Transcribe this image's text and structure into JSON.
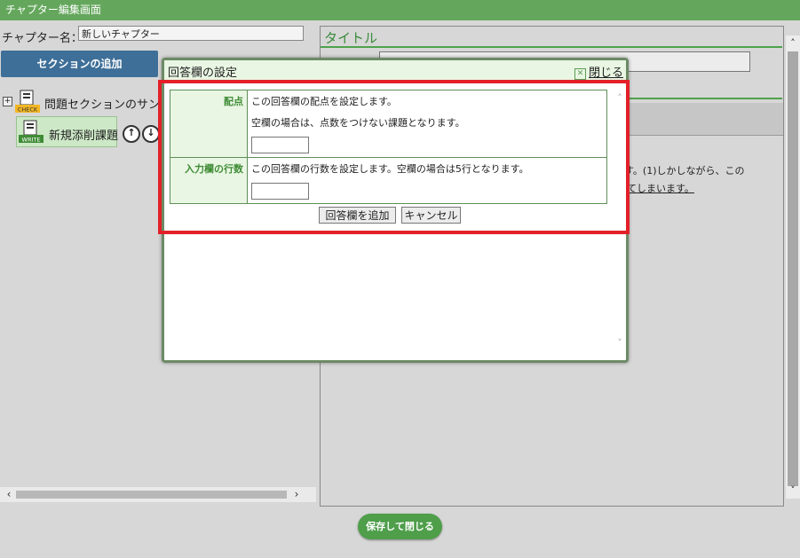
{
  "window": {
    "title": "チャプター編集画面"
  },
  "chapter": {
    "name_label": "チャプター名：",
    "name_value": "新しいチャプター"
  },
  "toolbar": {
    "add_section_label": "セクションの追加"
  },
  "tree": {
    "items": [
      {
        "label": "問題セクションのサン",
        "icon": "check-icon",
        "icon_text": "CHECK"
      },
      {
        "label": "新規添削課題",
        "icon": "write-icon",
        "icon_text": "WRITE"
      }
    ],
    "move_up": "↑",
    "move_down": "↓",
    "expand": "+"
  },
  "right_pane": {
    "title_label": "タイトル",
    "body_text_1": "具です。(1)しかしながら、この",
    "body_text_2": "てしまいます。"
  },
  "footer": {
    "save_close_label": "保存して閉じる"
  },
  "dialog": {
    "title": "回答欄の設定",
    "close_label": "閉じる",
    "close_icon": "☒",
    "rows": [
      {
        "label": "配点",
        "lines": [
          "この回答欄の配点を設定します。",
          "空欄の場合は、点数をつけない課題となります。"
        ],
        "value": ""
      },
      {
        "label": "入力欄の行数",
        "lines": [
          "この回答欄の行数を設定します。空欄の場合は5行となります。"
        ],
        "value": ""
      }
    ],
    "add_button": "回答欄を追加",
    "cancel_button": "キャンセル"
  },
  "colors": {
    "accent_green": "#64a75c",
    "highlight_red": "#e32028",
    "button_blue": "#3e6f98"
  }
}
